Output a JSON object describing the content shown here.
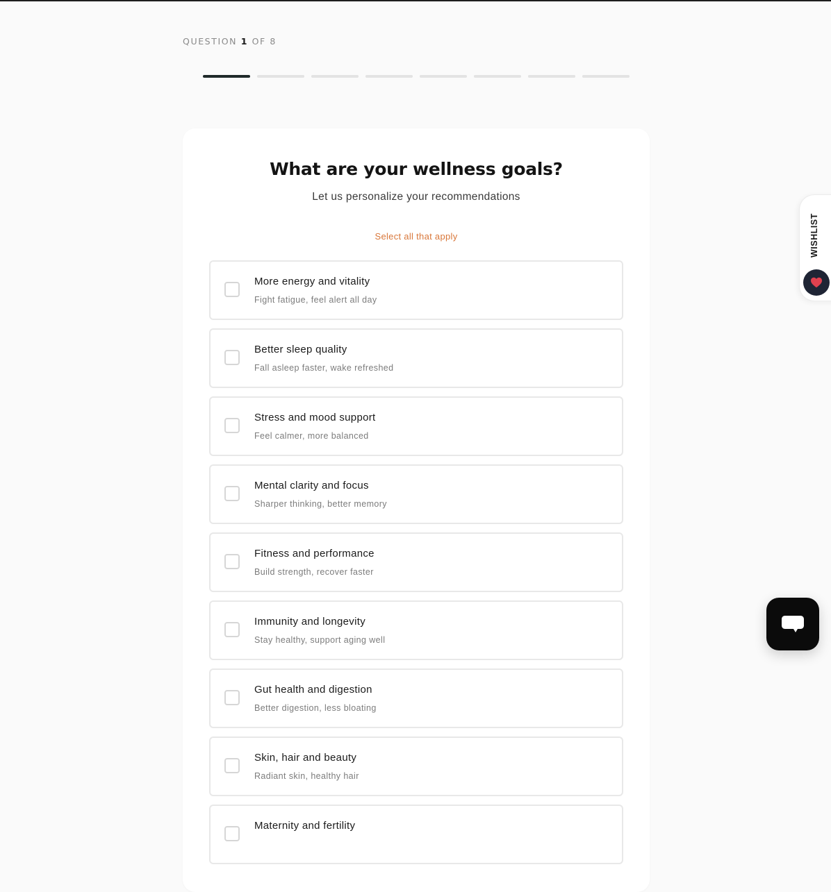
{
  "progress": {
    "label_prefix": "QUESTION",
    "current": "1",
    "label_middle": "OF",
    "total": "8",
    "step_count": 8,
    "active_step": 1
  },
  "card": {
    "title": "What are your wellness goals?",
    "subtitle": "Let us personalize your recommendations",
    "hint": "Select all that apply"
  },
  "options": [
    {
      "title": "More energy and vitality",
      "desc": "Fight fatigue, feel alert all day",
      "checked": false
    },
    {
      "title": "Better sleep quality",
      "desc": "Fall asleep faster, wake refreshed",
      "checked": false
    },
    {
      "title": "Stress and mood support",
      "desc": "Feel calmer, more balanced",
      "checked": false
    },
    {
      "title": "Mental clarity and focus",
      "desc": "Sharper thinking, better memory",
      "checked": false
    },
    {
      "title": "Fitness and performance",
      "desc": "Build strength, recover faster",
      "checked": false
    },
    {
      "title": "Immunity and longevity",
      "desc": "Stay healthy, support aging well",
      "checked": false
    },
    {
      "title": "Gut health and digestion",
      "desc": "Better digestion, less bloating",
      "checked": false
    },
    {
      "title": "Skin, hair and beauty",
      "desc": "Radiant skin, healthy hair",
      "checked": false
    },
    {
      "title": "Maternity and fertility",
      "desc": "",
      "checked": false
    }
  ],
  "wishlist": {
    "label": "WISHLIST",
    "icon": "heart-icon",
    "heart_color": "#e0414f"
  },
  "chat": {
    "icon": "chat-bubble-icon"
  },
  "colors": {
    "accent": "#d9773a",
    "progress_active": "#1f2a2a",
    "progress_inactive": "#e3e3e3"
  }
}
